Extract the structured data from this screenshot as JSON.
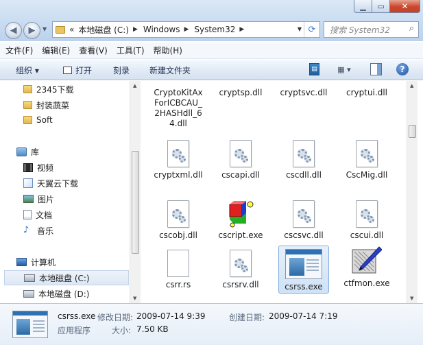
{
  "address": {
    "overflow": "«",
    "crumbs": [
      "本地磁盘 (C:)",
      "Windows",
      "System32"
    ]
  },
  "search": {
    "placeholder": "搜索 System32"
  },
  "menu": [
    "文件(F)",
    "编辑(E)",
    "查看(V)",
    "工具(T)",
    "帮助(H)"
  ],
  "command": {
    "organize": "组织 ▾",
    "open": "打开",
    "burn": "刻录",
    "new_folder": "新建文件夹"
  },
  "nav": {
    "items": [
      {
        "label": "2345下载",
        "icon": "folder-icon"
      },
      {
        "label": "封装蔬菜",
        "icon": "folder-icon"
      },
      {
        "label": "Soft",
        "icon": "folder-icon"
      },
      {
        "label": "库",
        "icon": "library-icon"
      },
      {
        "label": "视频",
        "icon": "video-icon"
      },
      {
        "label": "天翼云下载",
        "icon": "cloud-download-icon"
      },
      {
        "label": "图片",
        "icon": "pictures-icon"
      },
      {
        "label": "文档",
        "icon": "documents-icon"
      },
      {
        "label": "音乐",
        "icon": "music-icon"
      },
      {
        "label": "计算机",
        "icon": "computer-icon"
      },
      {
        "label": "本地磁盘 (C:)",
        "icon": "drive-icon"
      },
      {
        "label": "本地磁盘 (D:)",
        "icon": "drive-icon"
      }
    ]
  },
  "files": [
    {
      "name": "CryptoKitAxForICBCAU_2HASHdll_64.dll",
      "icon": "dll-file-icon"
    },
    {
      "name": "cryptsp.dll",
      "icon": "dll-file-icon"
    },
    {
      "name": "cryptsvc.dll",
      "icon": "dll-file-icon"
    },
    {
      "name": "cryptui.dll",
      "icon": "dll-file-icon"
    },
    {
      "name": "cryptxml.dll",
      "icon": "dll-file-icon"
    },
    {
      "name": "cscapi.dll",
      "icon": "dll-file-icon"
    },
    {
      "name": "cscdll.dll",
      "icon": "dll-file-icon"
    },
    {
      "name": "CscMig.dll",
      "icon": "dll-file-icon"
    },
    {
      "name": "cscobj.dll",
      "icon": "dll-file-icon"
    },
    {
      "name": "cscript.exe",
      "icon": "script-host-icon"
    },
    {
      "name": "cscsvc.dll",
      "icon": "dll-file-icon"
    },
    {
      "name": "cscui.dll",
      "icon": "dll-file-icon"
    },
    {
      "name": "csrr.rs",
      "icon": "blank-file-icon"
    },
    {
      "name": "csrsrv.dll",
      "icon": "dll-file-icon"
    },
    {
      "name": "csrss.exe",
      "icon": "application-icon"
    },
    {
      "name": "ctfmon.exe",
      "icon": "pen-tablet-icon"
    }
  ],
  "details": {
    "filename": "csrss.exe",
    "type": "应用程序",
    "modified_label": "修改日期:",
    "modified_value": "2009-07-14 9:39",
    "size_label": "大小:",
    "size_value": "7.50 KB",
    "created_label": "创建日期:",
    "created_value": "2009-07-14 7:19"
  }
}
